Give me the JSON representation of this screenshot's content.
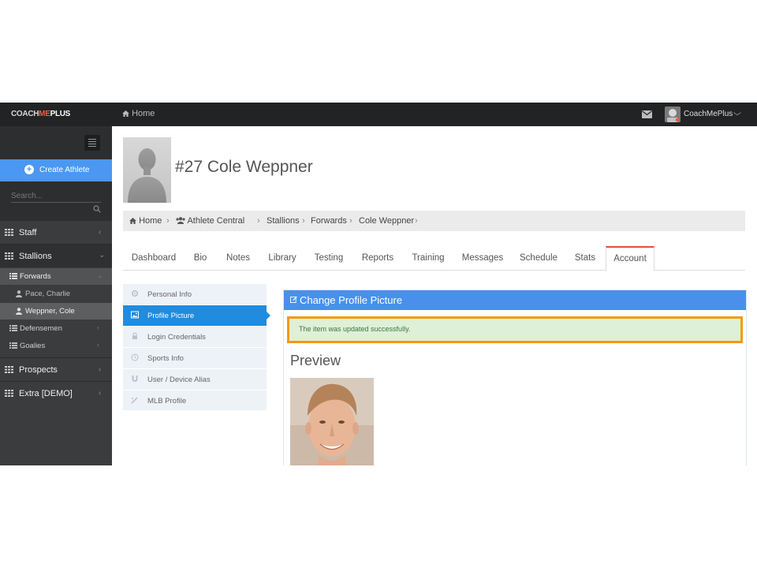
{
  "topbar": {
    "brand_part1": "COACH",
    "brand_part2": "ME",
    "brand_part3": "PLUS",
    "home": "Home",
    "user_name": "CoachMePlus"
  },
  "sidebar": {
    "create_button": "Create Athlete",
    "search_placeholder": "Search...",
    "sections": {
      "staff": "Staff",
      "stallions": "Stallions",
      "forwards": "Forwards",
      "player1": "Pace, Charlie",
      "player2": "Weppner, Cole",
      "defensemen": "Defensemen",
      "goalies": "Goalies",
      "prospects": "Prospects",
      "extra": "Extra [DEMO]"
    }
  },
  "athlete": {
    "title": "#27 Cole Weppner"
  },
  "breadcrumb": {
    "home": "Home",
    "athlete_central": "Athlete Central",
    "team": "Stallions",
    "group": "Forwards",
    "athlete": "Cole Weppner"
  },
  "tabs": {
    "dashboard": "Dashboard",
    "bio": "Bio",
    "notes": "Notes",
    "library": "Library",
    "testing": "Testing",
    "reports": "Reports",
    "training": "Training",
    "messages": "Messages",
    "schedule": "Schedule",
    "stats": "Stats",
    "account": "Account",
    "active": "Account"
  },
  "account_nav": {
    "personal_info": "Personal Info",
    "profile_picture": "Profile Picture",
    "login_credentials": "Login Credentials",
    "sports_info": "Sports Info",
    "user_device_alias": "User / Device Alias",
    "mlb_profile": "MLB Profile"
  },
  "panel": {
    "title": "Change Profile Picture",
    "alert": "The item was updated successfully.",
    "preview_heading": "Preview"
  },
  "colors": {
    "topbar": "#222325",
    "sidebar": "#3b3c3e",
    "primary": "#4a98f2",
    "active_subnav": "#1f8ce0",
    "alert_border": "#f39a12",
    "alert_bg": "#dff0d8",
    "tab_accent": "#e84c3d",
    "brand_accent": "#e8603c"
  }
}
